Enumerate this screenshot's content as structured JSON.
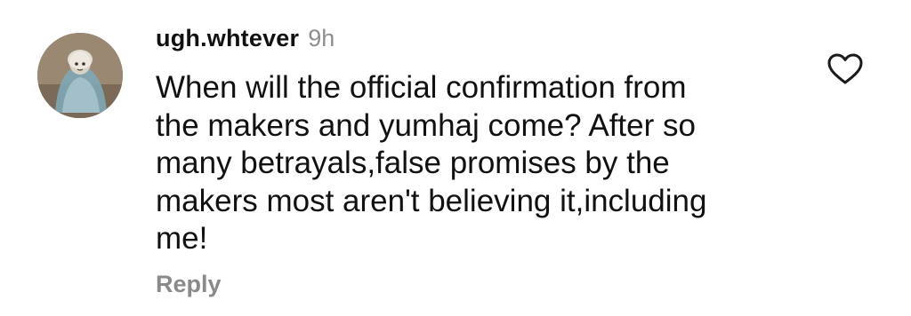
{
  "comment": {
    "username": "ugh.whtever",
    "time": "9h",
    "text": "When will the official confirmation from\nthe makers and yumhaj come? After so\nmany betrayals,false promises by the\nmakers most aren't believing it,including\nme!",
    "reply_label": "Reply",
    "like_icon": "heart-outline-icon",
    "avatar_icon": "profile-avatar"
  },
  "colors": {
    "text": "#111111",
    "muted": "#8e8e8e",
    "reply": "#8a8a8a",
    "heart_stroke": "#1a1a1a",
    "background": "#ffffff"
  }
}
